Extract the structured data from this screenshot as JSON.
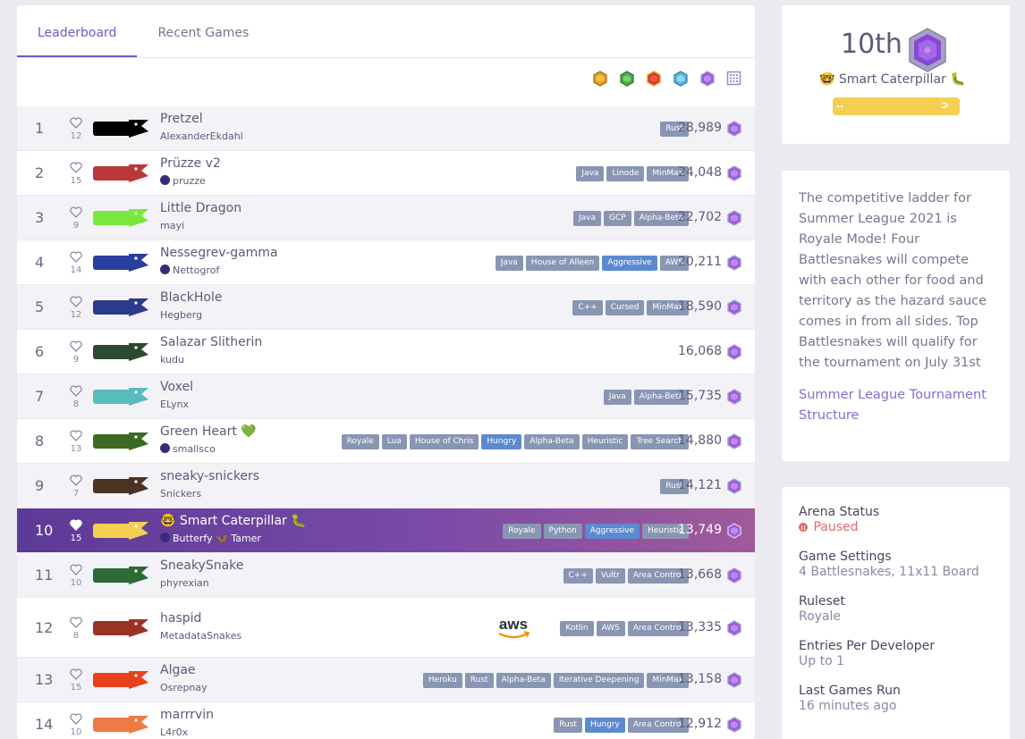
{
  "tabs": [
    "Leaderboard",
    "Recent Games"
  ],
  "filter_gems": [
    "gold-gem-icon",
    "green-gem-icon",
    "red-gem-icon",
    "blue-gem-icon",
    "purple-gem-icon"
  ],
  "leaderboard": [
    {
      "rank": "1",
      "likes": "12",
      "name": "Pretzel",
      "author": "AlexanderEkdahl",
      "tags": [
        "Rust"
      ],
      "score": "28,989",
      "color": "#000000"
    },
    {
      "rank": "2",
      "likes": "15",
      "name": "Prüzze v2",
      "author": "pruzze",
      "tags": [
        "Java",
        "Linode",
        "MinMax"
      ],
      "score": "24,048",
      "color": "#b9393a"
    },
    {
      "rank": "3",
      "likes": "9",
      "name": "Little Dragon",
      "author": "mayi",
      "tags": [
        "Java",
        "GCP",
        "Alpha-Beta"
      ],
      "score": "22,702",
      "color": "#78e83c"
    },
    {
      "rank": "4",
      "likes": "14",
      "name": "Nessegrev-gamma",
      "author": "Nettogrof",
      "tags": [
        "Java",
        "House of Alleen",
        "Aggressive",
        "AWS"
      ],
      "score": "20,211",
      "color": "#2a3ea0"
    },
    {
      "rank": "5",
      "likes": "12",
      "name": "BlackHole",
      "author": "Hegberg",
      "tags": [
        "C++",
        "Cursed",
        "MinMax"
      ],
      "score": "18,590",
      "color": "#2c3a8c"
    },
    {
      "rank": "6",
      "likes": "9",
      "name": "Salazar Slitherin",
      "author": "kudu",
      "tags": [],
      "score": "16,068",
      "color": "#2c4a2e"
    },
    {
      "rank": "7",
      "likes": "8",
      "name": "Voxel",
      "author": "ELynx",
      "tags": [
        "Java",
        "Alpha-Beta"
      ],
      "score": "15,735",
      "color": "#58bcbc"
    },
    {
      "rank": "8",
      "likes": "13",
      "name": "Green Heart 💚",
      "author": "smallsco",
      "tags": [
        "Royale",
        "Lua",
        "House of Chris",
        "Hungry",
        "Alpha-Beta",
        "Heuristic",
        "Tree Search"
      ],
      "score": "14,880",
      "color": "#3c6a22"
    },
    {
      "rank": "9",
      "likes": "7",
      "name": "sneaky-snickers",
      "author": "Snickers",
      "tags": [
        "Rust"
      ],
      "score": "14,121",
      "color": "#4a3322"
    },
    {
      "rank": "10",
      "likes": "15",
      "name": "🤓 Smart Caterpillar 🐛",
      "author": "Butterfy 🦋 Tamer",
      "tags": [
        "Royale",
        "Python",
        "Aggressive",
        "Heuristic"
      ],
      "score": "13,749",
      "color": "#f5cf52"
    },
    {
      "rank": "11",
      "likes": "10",
      "name": "SneakySnake",
      "author": "phyrexian",
      "tags": [
        "C++",
        "Vultr",
        "Area Control"
      ],
      "score": "13,668",
      "color": "#2c6a36"
    },
    {
      "rank": "12",
      "likes": "8",
      "name": "haspid",
      "author": "MetadataSnakes",
      "tags": [
        "Kotlin",
        "AWS",
        "Area Control"
      ],
      "score": "13,335",
      "color": "#9a3324",
      "sponsor": "aws"
    },
    {
      "rank": "13",
      "likes": "15",
      "name": "Algae",
      "author": "Osrepnay",
      "tags": [
        "Heroku",
        "Rust",
        "Alpha-Beta",
        "Iterative Deepening",
        "MinMax"
      ],
      "score": "13,158",
      "color": "#e8401c"
    },
    {
      "rank": "14",
      "likes": "10",
      "name": "marrrvin",
      "author": "L4r0x",
      "tags": [
        "Rust",
        "Hungry",
        "Area Control"
      ],
      "score": "12,912",
      "color": "#f07a44"
    }
  ],
  "profile": {
    "place": "10th",
    "name": "🤓 Smart Caterpillar 🐛"
  },
  "about": {
    "text": "The competitive ladder for Summer League 2021 is Royale Mode! Four Battlesnakes will compete with each other for food and territory as the hazard sauce comes in from all sides. Top Battlesnakes will qualify for the tournament on July 31st",
    "link": "Summer League Tournament Structure"
  },
  "arena": [
    {
      "label": "Arena Status",
      "value": "Paused"
    },
    {
      "label": "Game Settings",
      "value": "4 Battlesnakes, 11x11 Board"
    },
    {
      "label": "Ruleset",
      "value": "Royale"
    },
    {
      "label": "Entries Per Developer",
      "value": "Up to 1"
    },
    {
      "label": "Last Games Run",
      "value": "16 minutes ago"
    }
  ]
}
